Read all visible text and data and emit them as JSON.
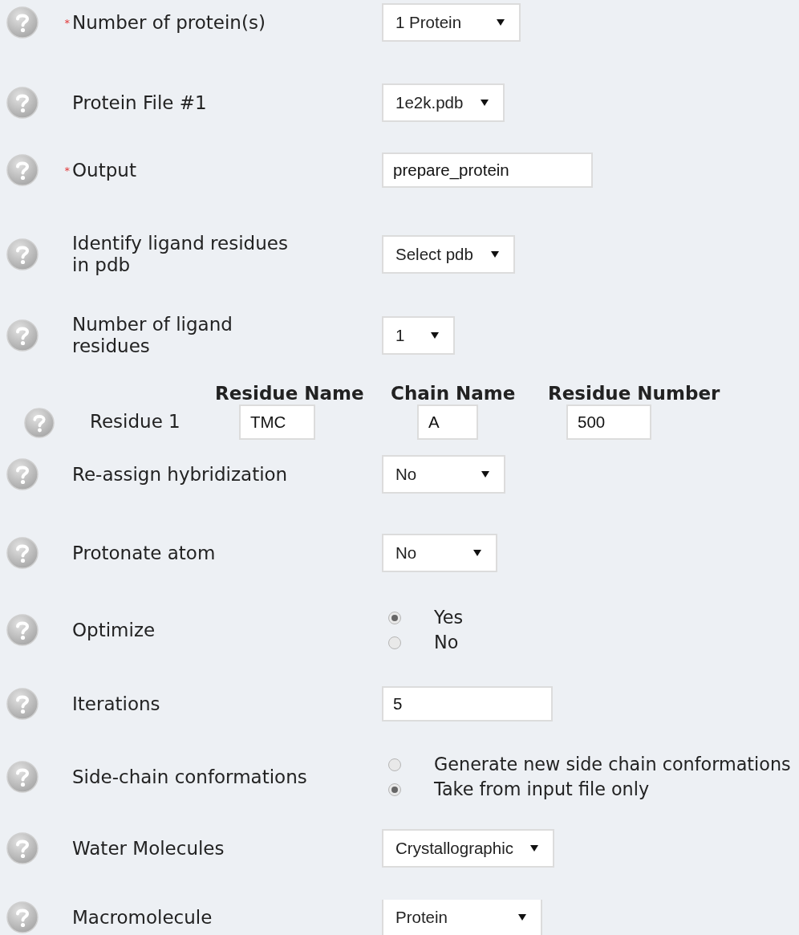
{
  "fields": [
    {
      "kind": "select",
      "required_mark": "*",
      "label": "Number of protein(s)",
      "value": "1 Protein"
    },
    {
      "kind": "select",
      "label": "Protein File #1",
      "value": "1e2k.pdb"
    },
    {
      "kind": "text",
      "required_mark": "*",
      "label": "Output",
      "value": "prepare_protein"
    },
    {
      "kind": "select",
      "label": "Identify ligand residues in pdb",
      "value": "Select pdb"
    },
    {
      "kind": "select",
      "label": "Number of ligand residues",
      "value": "1"
    },
    {
      "kind": "residues",
      "label": "Residue 1",
      "columns": [
        {
          "header": "Residue Name",
          "value": "TMC"
        },
        {
          "header": "Chain Name",
          "value": "A"
        },
        {
          "header": "Residue Number",
          "value": "500"
        }
      ]
    },
    {
      "kind": "select",
      "label": "Re-assign hybridization",
      "value": "No"
    },
    {
      "kind": "select",
      "label": "Protonate atom",
      "value": "No"
    },
    {
      "kind": "radio",
      "label": "Optimize",
      "options": [
        {
          "label": "Yes",
          "selected": true
        },
        {
          "label": "No",
          "selected": false
        }
      ]
    },
    {
      "kind": "text",
      "label": "Iterations",
      "value": "5"
    },
    {
      "kind": "radio",
      "label": "Side-chain conformations",
      "options": [
        {
          "label": "Generate new side chain conformations",
          "selected": false
        },
        {
          "label": "Take from input file only",
          "selected": true
        }
      ]
    },
    {
      "kind": "select",
      "label": "Water Molecules",
      "value": "Crystallographic"
    },
    {
      "kind": "select",
      "label": "Macromolecule",
      "value": "Protein"
    }
  ]
}
